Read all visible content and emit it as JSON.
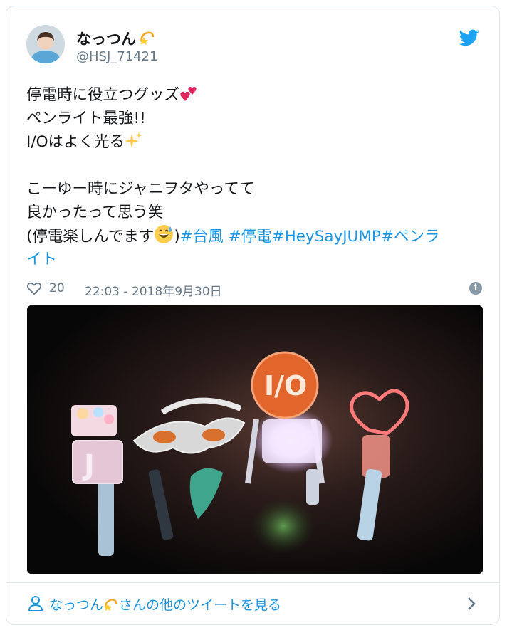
{
  "tweet": {
    "display_name": "なっつん",
    "handle": "@HSJ_71421",
    "lines": [
      "停電時に役立つグッズ",
      "ペンライト最強!!",
      "I/Oはよく光る",
      "",
      "こーゆー時にジャニヲタやってて",
      "良かったって思う笑",
      "(停電楽しんでます",
      "イト"
    ],
    "hashtags": [
      "#台風",
      "#停電",
      "#HeySayJUMP",
      "#ペンラ"
    ],
    "likes": "20",
    "timestamp": "22:03 - 2018年9月30日",
    "info_glyph": "i"
  },
  "footer": {
    "see_more": "さんの他のツイートを見る"
  },
  "colors": {
    "link": "#1b95e0",
    "secondary": "#657786",
    "border": "#e1e8ed"
  },
  "icons": [
    "twitter-bird-icon",
    "heart-icon",
    "info-icon",
    "person-icon",
    "chevron-right-icon"
  ]
}
